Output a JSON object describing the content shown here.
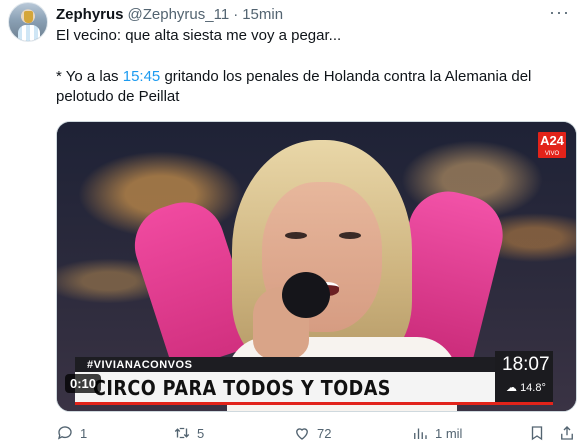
{
  "tweet": {
    "display_name": "Zephyrus",
    "handle": "@Zephyrus_11",
    "separator": "·",
    "time": "15min",
    "text_line1": "El vecino: que alta siesta me voy a pegar...",
    "text_line2_before": "* Yo a las ",
    "text_line2_link": "15:45",
    "text_line2_after": " gritando los penales de Holanda contra la Alemania del pelotudo de Peillat"
  },
  "video": {
    "channel_logo": "A24",
    "channel_logo_sub": "VIVO",
    "hashtag": "#VIVIANACONVOS",
    "headline": "CIRCO PARA TODOS Y TODAS",
    "clock": "18:07",
    "weather": "14.8°",
    "duration": "0:10"
  },
  "actions": {
    "replies": "1",
    "retweets": "5",
    "likes": "72",
    "views": "1 mil"
  },
  "icons": {
    "more": "more-options-icon",
    "reply": "reply-icon",
    "retweet": "retweet-icon",
    "like": "heart-icon",
    "views": "views-icon",
    "bookmark": "bookmark-icon",
    "share": "share-icon"
  },
  "colors": {
    "link": "#1d9bf0",
    "secondary_text": "#536471",
    "brand_red": "#e2231a"
  }
}
